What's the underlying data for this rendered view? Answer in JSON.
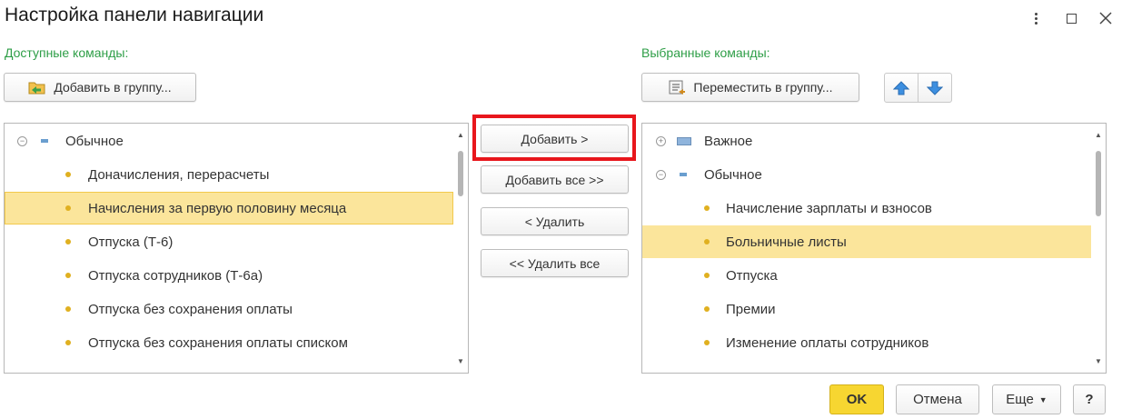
{
  "dialog": {
    "title": "Настройка панели навигации",
    "more_icon": "vertical-dots-icon",
    "maximize_icon": "maximize-icon",
    "close_icon": "close-icon"
  },
  "available": {
    "label": "Доступные команды:",
    "add_to_group_label": "Добавить в группу...",
    "items": [
      {
        "label": "Обычное",
        "type": "group",
        "expanded": true
      },
      {
        "label": "Доначисления, перерасчеты",
        "type": "item"
      },
      {
        "label": "Начисления за первую половину месяца",
        "type": "item",
        "selected": true
      },
      {
        "label": "Отпуска (Т-6)",
        "type": "item"
      },
      {
        "label": "Отпуска сотрудников (Т-6а)",
        "type": "item"
      },
      {
        "label": "Отпуска без сохранения оплаты",
        "type": "item"
      },
      {
        "label": "Отпуска без сохранения оплаты списком",
        "type": "item"
      }
    ]
  },
  "middle": {
    "add_label": "Добавить >",
    "add_all_label": "Добавить все >>",
    "remove_label": "< Удалить",
    "remove_all_label": "<< Удалить все"
  },
  "selected": {
    "label": "Выбранные команды:",
    "move_to_group_label": "Переместить в группу...",
    "move_up_icon": "arrow-up-icon",
    "move_down_icon": "arrow-down-icon",
    "items": [
      {
        "label": "Важное",
        "type": "group",
        "expanded": false
      },
      {
        "label": "Обычное",
        "type": "group",
        "expanded": true
      },
      {
        "label": "Начисление зарплаты и взносов",
        "type": "item"
      },
      {
        "label": "Больничные листы",
        "type": "item",
        "selected": true
      },
      {
        "label": "Отпуска",
        "type": "item"
      },
      {
        "label": "Премии",
        "type": "item"
      },
      {
        "label": "Изменение оплаты сотрудников",
        "type": "item"
      }
    ]
  },
  "footer": {
    "ok_label": "OK",
    "cancel_label": "Отмена",
    "more_label": "Еще",
    "help_label": "?"
  },
  "colors": {
    "section_label": "#2e9e47",
    "selection": "#fbe59b",
    "ok_button": "#f7d631",
    "highlight_frame": "#e8161c"
  }
}
